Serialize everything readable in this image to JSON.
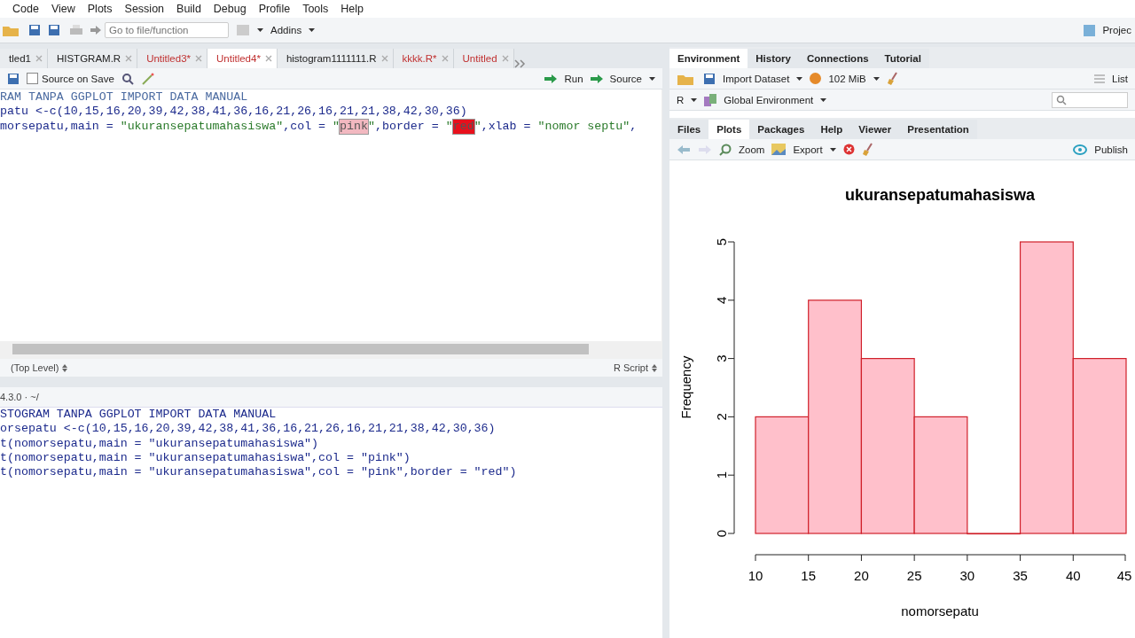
{
  "menu": [
    "Code",
    "View",
    "Plots",
    "Session",
    "Build",
    "Debug",
    "Profile",
    "Tools",
    "Help"
  ],
  "toolbar": {
    "goto": {
      "placeholder": "Go to file/function"
    },
    "addins": "Addins",
    "project": "Projec"
  },
  "editor": {
    "tabs": [
      {
        "label": "tled1",
        "modified": false,
        "selected": false
      },
      {
        "label": "HISTGRAM.R",
        "modified": false,
        "selected": false
      },
      {
        "label": "Untitled3*",
        "modified": true,
        "selected": false
      },
      {
        "label": "Untitled4*",
        "modified": true,
        "selected": true
      },
      {
        "label": "histogram1111111.R",
        "modified": false,
        "selected": false
      },
      {
        "label": "kkkk.R*",
        "modified": true,
        "selected": false
      },
      {
        "label": "Untitled",
        "modified": true,
        "selected": false
      }
    ],
    "source_on_save": {
      "label": "Source on Save",
      "checked": false
    },
    "run": "Run",
    "source": "Source",
    "lines": [
      [
        {
          "text": "RAM TANPA GGPLOT IMPORT DATA MANUAL",
          "kind": "comment"
        }
      ],
      [
        {
          "text": "patu <-c(10,15,16,20,39,42,38,41,36,16,21,26,16,21,21,38,42,30,36)",
          "kind": "code"
        }
      ],
      [
        {
          "text": "morsepatu,main = ",
          "kind": "code"
        },
        {
          "text": "\"ukuransepatumahasiswa\"",
          "kind": "string"
        },
        {
          "text": ",col = ",
          "kind": "code"
        },
        {
          "text": "\"",
          "kind": "string"
        },
        {
          "text": "pink",
          "kind": "match",
          "color": "#f2b8c0"
        },
        {
          "text": "\"",
          "kind": "string"
        },
        {
          "text": ",border = ",
          "kind": "code"
        },
        {
          "text": "\"",
          "kind": "string"
        },
        {
          "text": "red",
          "kind": "match",
          "color": "#e8101c"
        },
        {
          "text": "\"",
          "kind": "string"
        },
        {
          "text": ",xlab = ",
          "kind": "code"
        },
        {
          "text": "\"nomor septu\"",
          "kind": "string"
        },
        {
          "text": ",",
          "kind": "code"
        }
      ]
    ],
    "scope": "(Top Level)",
    "file_type": "R Script"
  },
  "console": {
    "header": "4.3.0 · ~/",
    "lines": [
      "STOGRAM TANPA GGPLOT IMPORT DATA MANUAL",
      "orsepatu <-c(10,15,16,20,39,42,38,41,36,16,21,26,16,21,21,38,42,30,36)",
      "t(nomorsepatu,main = \"ukuransepatumahasiswa\")",
      "t(nomorsepatu,main = \"ukuransepatumahasiswa\",col = \"pink\")",
      "t(nomorsepatu,main = \"ukuransepatumahasiswa\",col = \"pink\",border = \"red\")"
    ]
  },
  "environment": {
    "tabs": [
      {
        "label": "Environment",
        "selected": true
      },
      {
        "label": "History",
        "selected": false
      },
      {
        "label": "Connections",
        "selected": false
      },
      {
        "label": "Tutorial",
        "selected": false
      }
    ],
    "import": "Import Dataset",
    "memory": "102 MiB",
    "view": "List",
    "language": "R",
    "scope": "Global Environment"
  },
  "files": {
    "tabs": [
      {
        "label": "Files",
        "selected": false
      },
      {
        "label": "Plots",
        "selected": true
      },
      {
        "label": "Packages",
        "selected": false
      },
      {
        "label": "Help",
        "selected": false
      },
      {
        "label": "Viewer",
        "selected": false
      },
      {
        "label": "Presentation",
        "selected": false
      }
    ],
    "zoom": "Zoom",
    "export": "Export",
    "publish": "Publish"
  },
  "plot": {
    "chart_data": {
      "type": "bar",
      "title": "ukuransepatumahasiswa",
      "xlabel": "nomorsepatu",
      "ylabel": "Frequency",
      "x": [
        12.5,
        17.5,
        22.5,
        27.5,
        32.5,
        37.5,
        42.5
      ],
      "values": [
        2,
        4,
        3,
        2,
        0,
        5,
        3
      ],
      "xlim": [
        10,
        45
      ],
      "ylim": [
        0,
        5
      ],
      "xticks": [
        10,
        15,
        20,
        25,
        30,
        35,
        40,
        45
      ],
      "yticks": [
        0,
        1,
        2,
        3,
        4,
        5
      ]
    }
  }
}
